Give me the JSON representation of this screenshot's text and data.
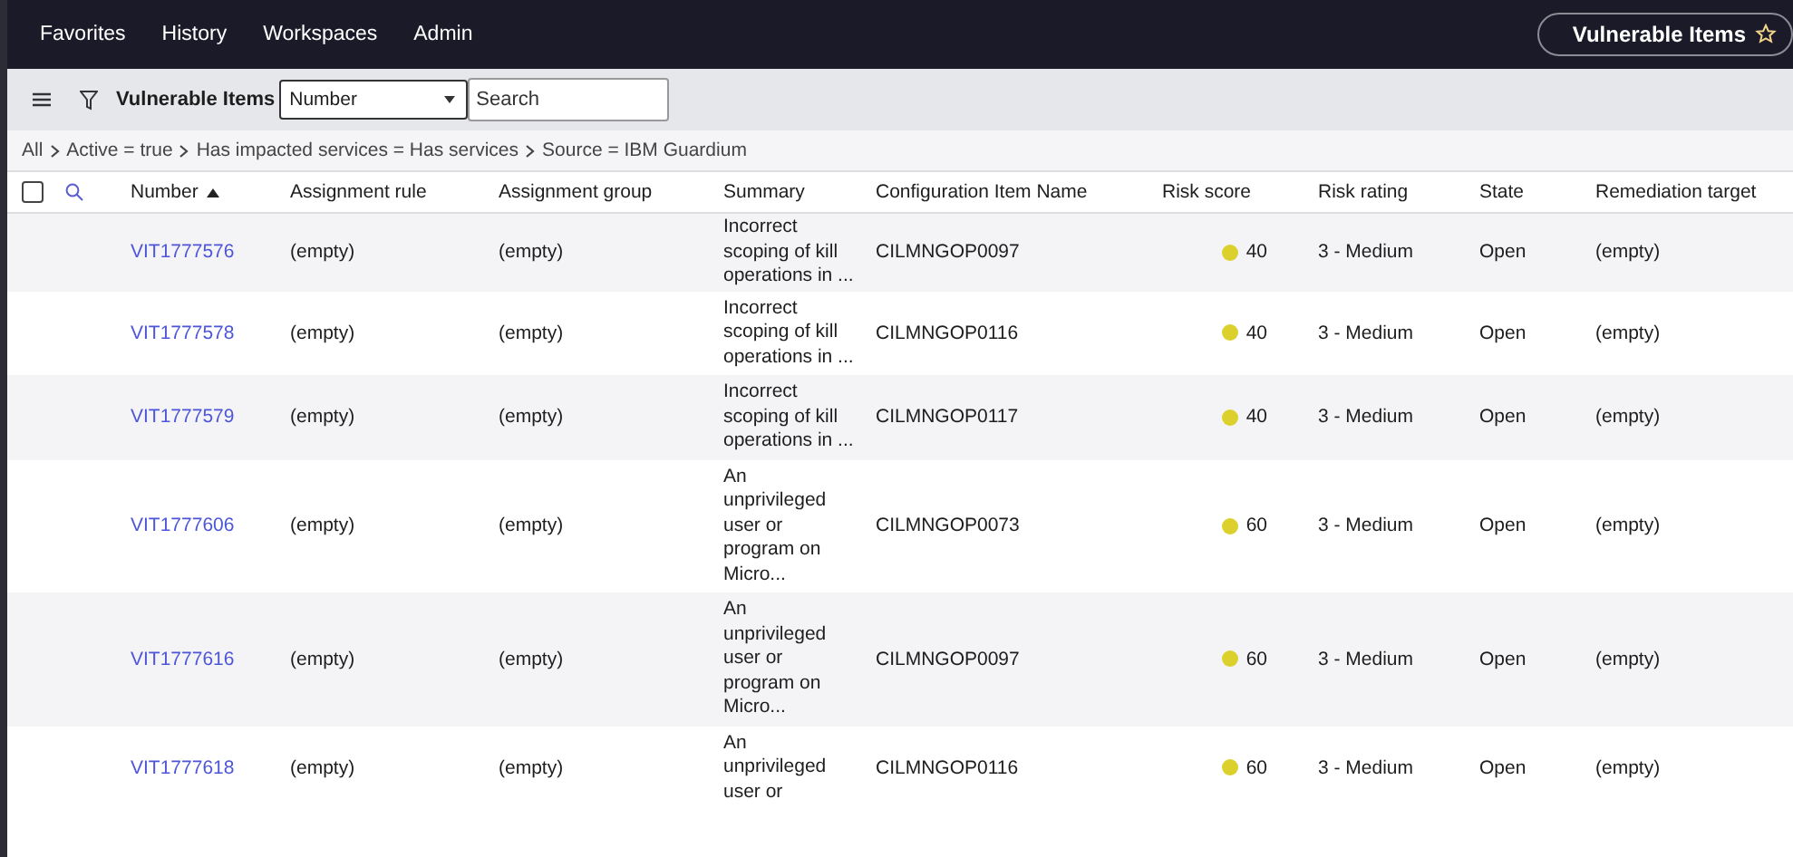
{
  "nav": {
    "items": [
      "Favorites",
      "History",
      "Workspaces",
      "Admin"
    ],
    "current_page": "Vulnerable Items"
  },
  "toolbar": {
    "title": "Vulnerable Items",
    "field_select": {
      "value": "Number"
    },
    "search": {
      "placeholder": "Search"
    }
  },
  "breadcrumbs": [
    "All",
    "Active = true",
    "Has impacted services = Has services",
    "Source = IBM Guardium"
  ],
  "table": {
    "select_all_checked": false,
    "columns": [
      {
        "label": "Number",
        "sorted": true
      },
      {
        "label": "Assignment rule",
        "sorted": false
      },
      {
        "label": "Assignment group",
        "sorted": false
      },
      {
        "label": "Summary",
        "sorted": false
      },
      {
        "label": "Configuration Item Name",
        "sorted": false
      },
      {
        "label": "Risk score",
        "sorted": false
      },
      {
        "label": "Risk rating",
        "sorted": false
      },
      {
        "label": "State",
        "sorted": false
      },
      {
        "label": "Remediation target",
        "sorted": false
      }
    ],
    "rows": [
      {
        "number": "VIT1777576",
        "assignment_rule": "(empty)",
        "assignment_group": "(empty)",
        "summary": "Incorrect scoping of kill operations in ...",
        "ci_name": "CILMNGOP0097",
        "risk_score": "40",
        "risk_rating": "3 - Medium",
        "state": "Open",
        "remediation_target": "(empty)"
      },
      {
        "number": "VIT1777578",
        "assignment_rule": "(empty)",
        "assignment_group": "(empty)",
        "summary": "Incorrect scoping of kill operations in ...",
        "ci_name": "CILMNGOP0116",
        "risk_score": "40",
        "risk_rating": "3 - Medium",
        "state": "Open",
        "remediation_target": "(empty)"
      },
      {
        "number": "VIT1777579",
        "assignment_rule": "(empty)",
        "assignment_group": "(empty)",
        "summary": "Incorrect scoping of kill operations in ...",
        "ci_name": "CILMNGOP0117",
        "risk_score": "40",
        "risk_rating": "3 - Medium",
        "state": "Open",
        "remediation_target": "(empty)"
      },
      {
        "number": "VIT1777606",
        "assignment_rule": "(empty)",
        "assignment_group": "(empty)",
        "summary": "An unprivileged user or program on Micro...",
        "ci_name": "CILMNGOP0073",
        "risk_score": "60",
        "risk_rating": "3 - Medium",
        "state": "Open",
        "remediation_target": "(empty)"
      },
      {
        "number": "VIT1777616",
        "assignment_rule": "(empty)",
        "assignment_group": "(empty)",
        "summary": "An unprivileged user or program on Micro...",
        "ci_name": "CILMNGOP0097",
        "risk_score": "60",
        "risk_rating": "3 - Medium",
        "state": "Open",
        "remediation_target": "(empty)"
      },
      {
        "number": "VIT1777618",
        "assignment_rule": "(empty)",
        "assignment_group": "(empty)",
        "summary": "An unprivileged user or",
        "ci_name": "CILMNGOP0116",
        "risk_score": "60",
        "risk_rating": "3 - Medium",
        "state": "Open",
        "remediation_target": "(empty)"
      }
    ]
  }
}
